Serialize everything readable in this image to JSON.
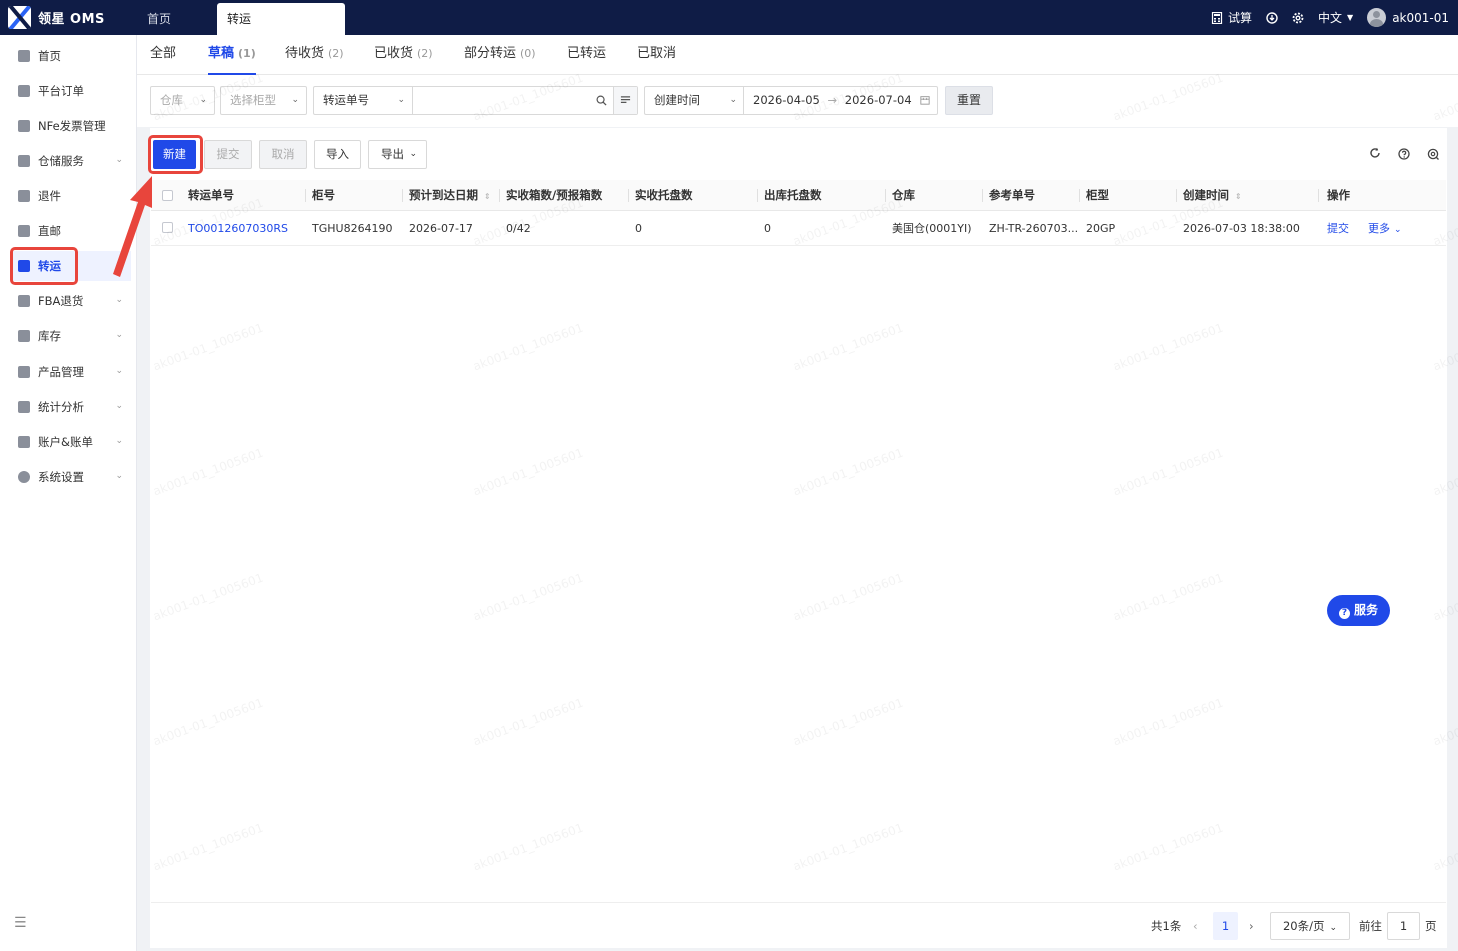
{
  "app": {
    "name": "领星 OMS"
  },
  "top_tabs": [
    {
      "label": "首页"
    },
    {
      "label": "转运"
    }
  ],
  "top_right": {
    "trial": "试算",
    "language": "中文",
    "user": "ak001-01"
  },
  "sidebar": {
    "items": [
      {
        "label": "首页",
        "icon": "home-icon"
      },
      {
        "label": "平台订单",
        "icon": "order-icon"
      },
      {
        "label": "NFe发票管理",
        "icon": "invoice-icon"
      },
      {
        "label": "仓储服务",
        "icon": "warehouse-icon"
      },
      {
        "label": "退件",
        "icon": "return-icon"
      },
      {
        "label": "直邮",
        "icon": "direct-mail-icon"
      },
      {
        "label": "转运",
        "icon": "transfer-icon"
      },
      {
        "label": "FBA退货",
        "icon": "fba-return-icon"
      },
      {
        "label": "库存",
        "icon": "inventory-icon"
      },
      {
        "label": "产品管理",
        "icon": "product-icon"
      },
      {
        "label": "统计分析",
        "icon": "stats-icon"
      },
      {
        "label": "账户&账单",
        "icon": "account-icon"
      },
      {
        "label": "系统设置",
        "icon": "settings-icon"
      }
    ]
  },
  "status_tabs": [
    {
      "label": "全部",
      "count": ""
    },
    {
      "label": "草稿",
      "count": "(1)"
    },
    {
      "label": "待收货",
      "count": "(2)"
    },
    {
      "label": "已收货",
      "count": "(2)"
    },
    {
      "label": "部分转运",
      "count": "(0)"
    },
    {
      "label": "已转运",
      "count": ""
    },
    {
      "label": "已取消",
      "count": ""
    }
  ],
  "filters": {
    "warehouse_placeholder": "仓库",
    "container_type_placeholder": "选择柜型",
    "search_field": "转运单号",
    "search_value": "",
    "time_field": "创建时间",
    "date_start": "2026-04-05",
    "date_end": "2026-07-04",
    "reset": "重置"
  },
  "toolbar": {
    "new": "新建",
    "submit": "提交",
    "cancel": "取消",
    "import": "导入",
    "export": "导出"
  },
  "table": {
    "headers": [
      "转运单号",
      "柜号",
      "预计到达日期",
      "实收箱数/预报箱数",
      "实收托盘数",
      "出库托盘数",
      "仓库",
      "参考单号",
      "柜型",
      "创建时间",
      "操作"
    ],
    "rows": [
      {
        "order_no": "TO0012607030RS",
        "container_no": "TGHU8264190",
        "eta": "2026-07-17",
        "boxes": "0/42",
        "pallets_received": "0",
        "pallets_out": "0",
        "warehouse": "美国仓(0001YI)",
        "reference": "ZH-TR-260703...",
        "container_type": "20GP",
        "created": "2026-07-03 18:38:00",
        "action_submit": "提交",
        "action_more": "更多"
      }
    ]
  },
  "pagination": {
    "total": "共1条",
    "current": "1",
    "page_size": "20条/页",
    "goto_label": "前往",
    "goto_value": "1",
    "page_unit": "页"
  },
  "service_button": "服务",
  "watermark": "ak001-01_1005601"
}
